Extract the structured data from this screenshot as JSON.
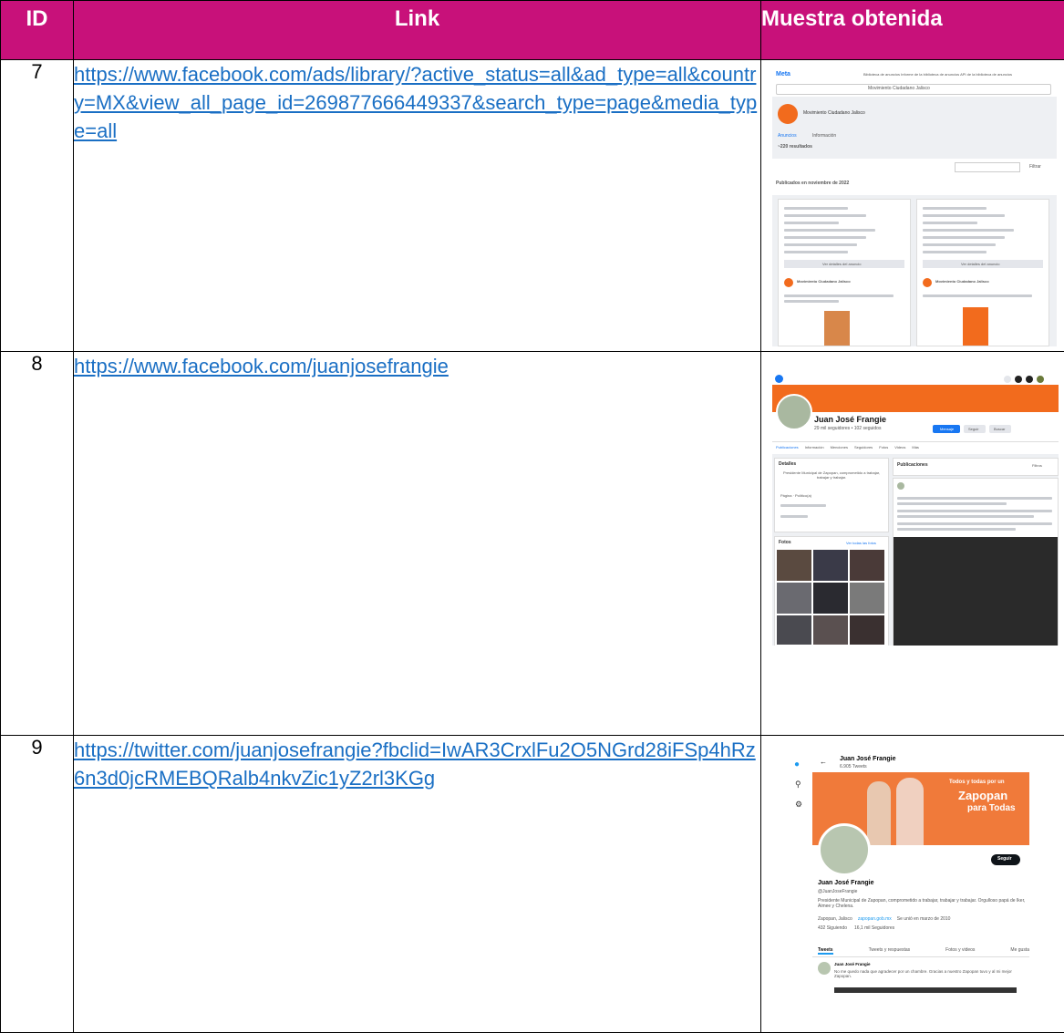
{
  "headers": {
    "id": "ID",
    "link": "Link",
    "sample": "Muestra obtenida"
  },
  "rows": [
    {
      "id": "7",
      "link": "https://www.facebook.com/ads/library/?active_status=all&ad_type=all&country=MX&view_all_page_id=269877666449337&search_type=page&media_type=all"
    },
    {
      "id": "8",
      "link": "https://www.facebook.com/juanjosefrangie"
    },
    {
      "id": "9",
      "link": "https://twitter.com/juanjosefrangie?fbclid=IwAR3CrxlFu2O5NGrd28iFSp4hRz6n3d0jcRMEBQRalb4nkvZic1yZ2rl3KGg"
    }
  ],
  "shot7": {
    "brand": "Meta",
    "nav": "Biblioteca de anuncios   Informe de la biblioteca de anuncios   API de la biblioteca de anuncios",
    "search": "Movimiento Ciudadano Jalisco",
    "page_name": "Movimiento Ciudadano Jalisco",
    "tabs": [
      "Anuncios",
      "Información"
    ],
    "results": "~220 resultados",
    "filter_btn": "Filtrar",
    "published": "Publicados en noviembre de 2022",
    "card_btn": "Ver detalles del anuncio",
    "advertiser": "Movimiento Ciudadano Jalisco"
  },
  "shot8": {
    "name": "Juan José Frangie",
    "followers": "29 mil seguidores • 102 seguidos",
    "btn_msg": "Mensaje",
    "btn_follow": "Seguir",
    "btn_search": "Buscar",
    "tabs": [
      "Publicaciones",
      "Información",
      "Menciones",
      "Seguidores",
      "Fotos",
      "Videos",
      "Más"
    ],
    "details": "Detalles",
    "bio": "Presidente Municipal de Zapopan, comprometido a trabajar, trabajar y trabajar.",
    "page_type": "Página · Político(a)",
    "posts": "Publicaciones",
    "filters": "Filtros",
    "photos": "Fotos",
    "see_all": "Ver todas las fotos"
  },
  "shot9": {
    "name": "Juan José Frangie",
    "tweets_count": "6.905 Tweets",
    "banner1": "Todos y todas por un",
    "banner2": "Zapopan",
    "banner3": "para Todas",
    "follow": "Seguir",
    "handle": "@JuanJoseFrangie",
    "bio": "Presidente Municipal de Zapopan, comprometido a trabajar, trabajar y trabajar. Orgulloso papá de Iker, Aimee y Chelena.",
    "loc": "Zapopan, Jalisco",
    "site": "zapopan.gob.mx",
    "joined": "Se unió en marzo de 2010",
    "following": "432 Siguiendo",
    "followers": "16,1 mil Seguidores",
    "tabs": [
      "Tweets",
      "Tweets y respuestas",
      "Fotos y videos",
      "Me gusta"
    ],
    "tweet_author": "Juan José Frangie",
    "tweet_text": "No me quedo nada que agradecer por un chambre. Gracias a nuestro Zapopan tuvo y al mi mejor Zapopan."
  }
}
